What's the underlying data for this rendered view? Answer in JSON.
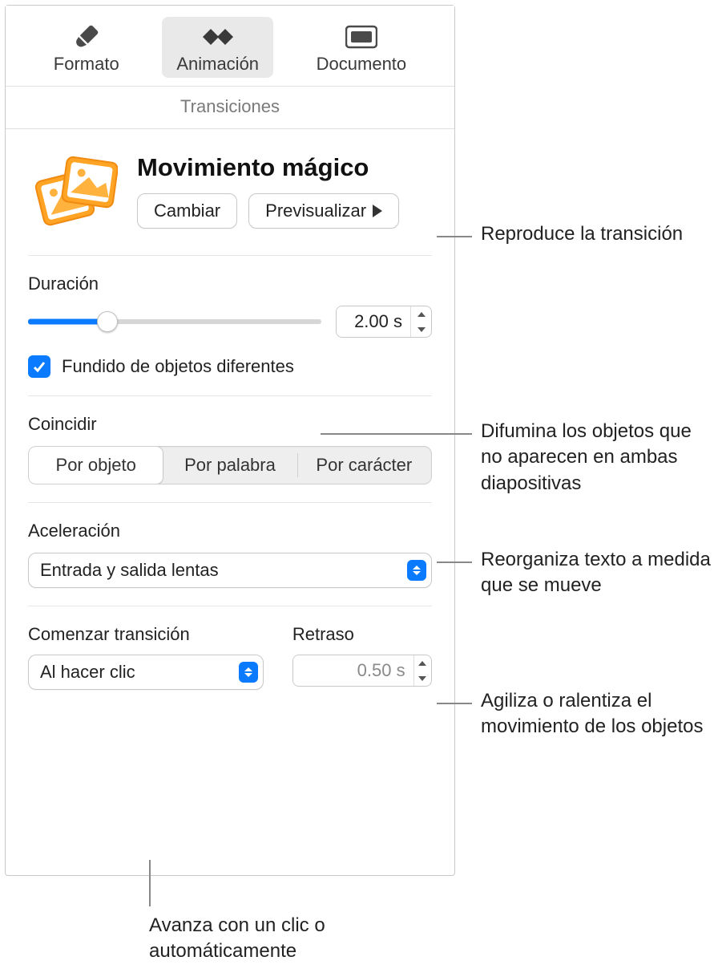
{
  "tabs": {
    "format": "Formato",
    "animation": "Animación",
    "document": "Documento"
  },
  "subheader": "Transiciones",
  "hero": {
    "title": "Movimiento mágico",
    "change": "Cambiar",
    "preview": "Previsualizar"
  },
  "duration": {
    "label": "Duración",
    "value": "2.00 s",
    "percent": 27
  },
  "fade": {
    "label": "Fundido de objetos diferentes",
    "checked": true
  },
  "match": {
    "label": "Coincidir",
    "options": [
      "Por objeto",
      "Por palabra",
      "Por carácter"
    ],
    "selected": 0
  },
  "accel": {
    "label": "Aceleración",
    "value": "Entrada y salida lentas"
  },
  "start": {
    "label": "Comenzar transición",
    "value": "Al hacer clic"
  },
  "delay": {
    "label": "Retraso",
    "value": "0.50 s"
  },
  "callouts": {
    "c1": "Reproduce la transición",
    "c2": "Difumina los objetos que no aparecen en ambas diapositivas",
    "c3": "Reorganiza texto a medida que se mueve",
    "c4": "Agiliza o ralentiza el movimiento de los objetos",
    "c5": "Avanza con un clic o automáticamente"
  }
}
